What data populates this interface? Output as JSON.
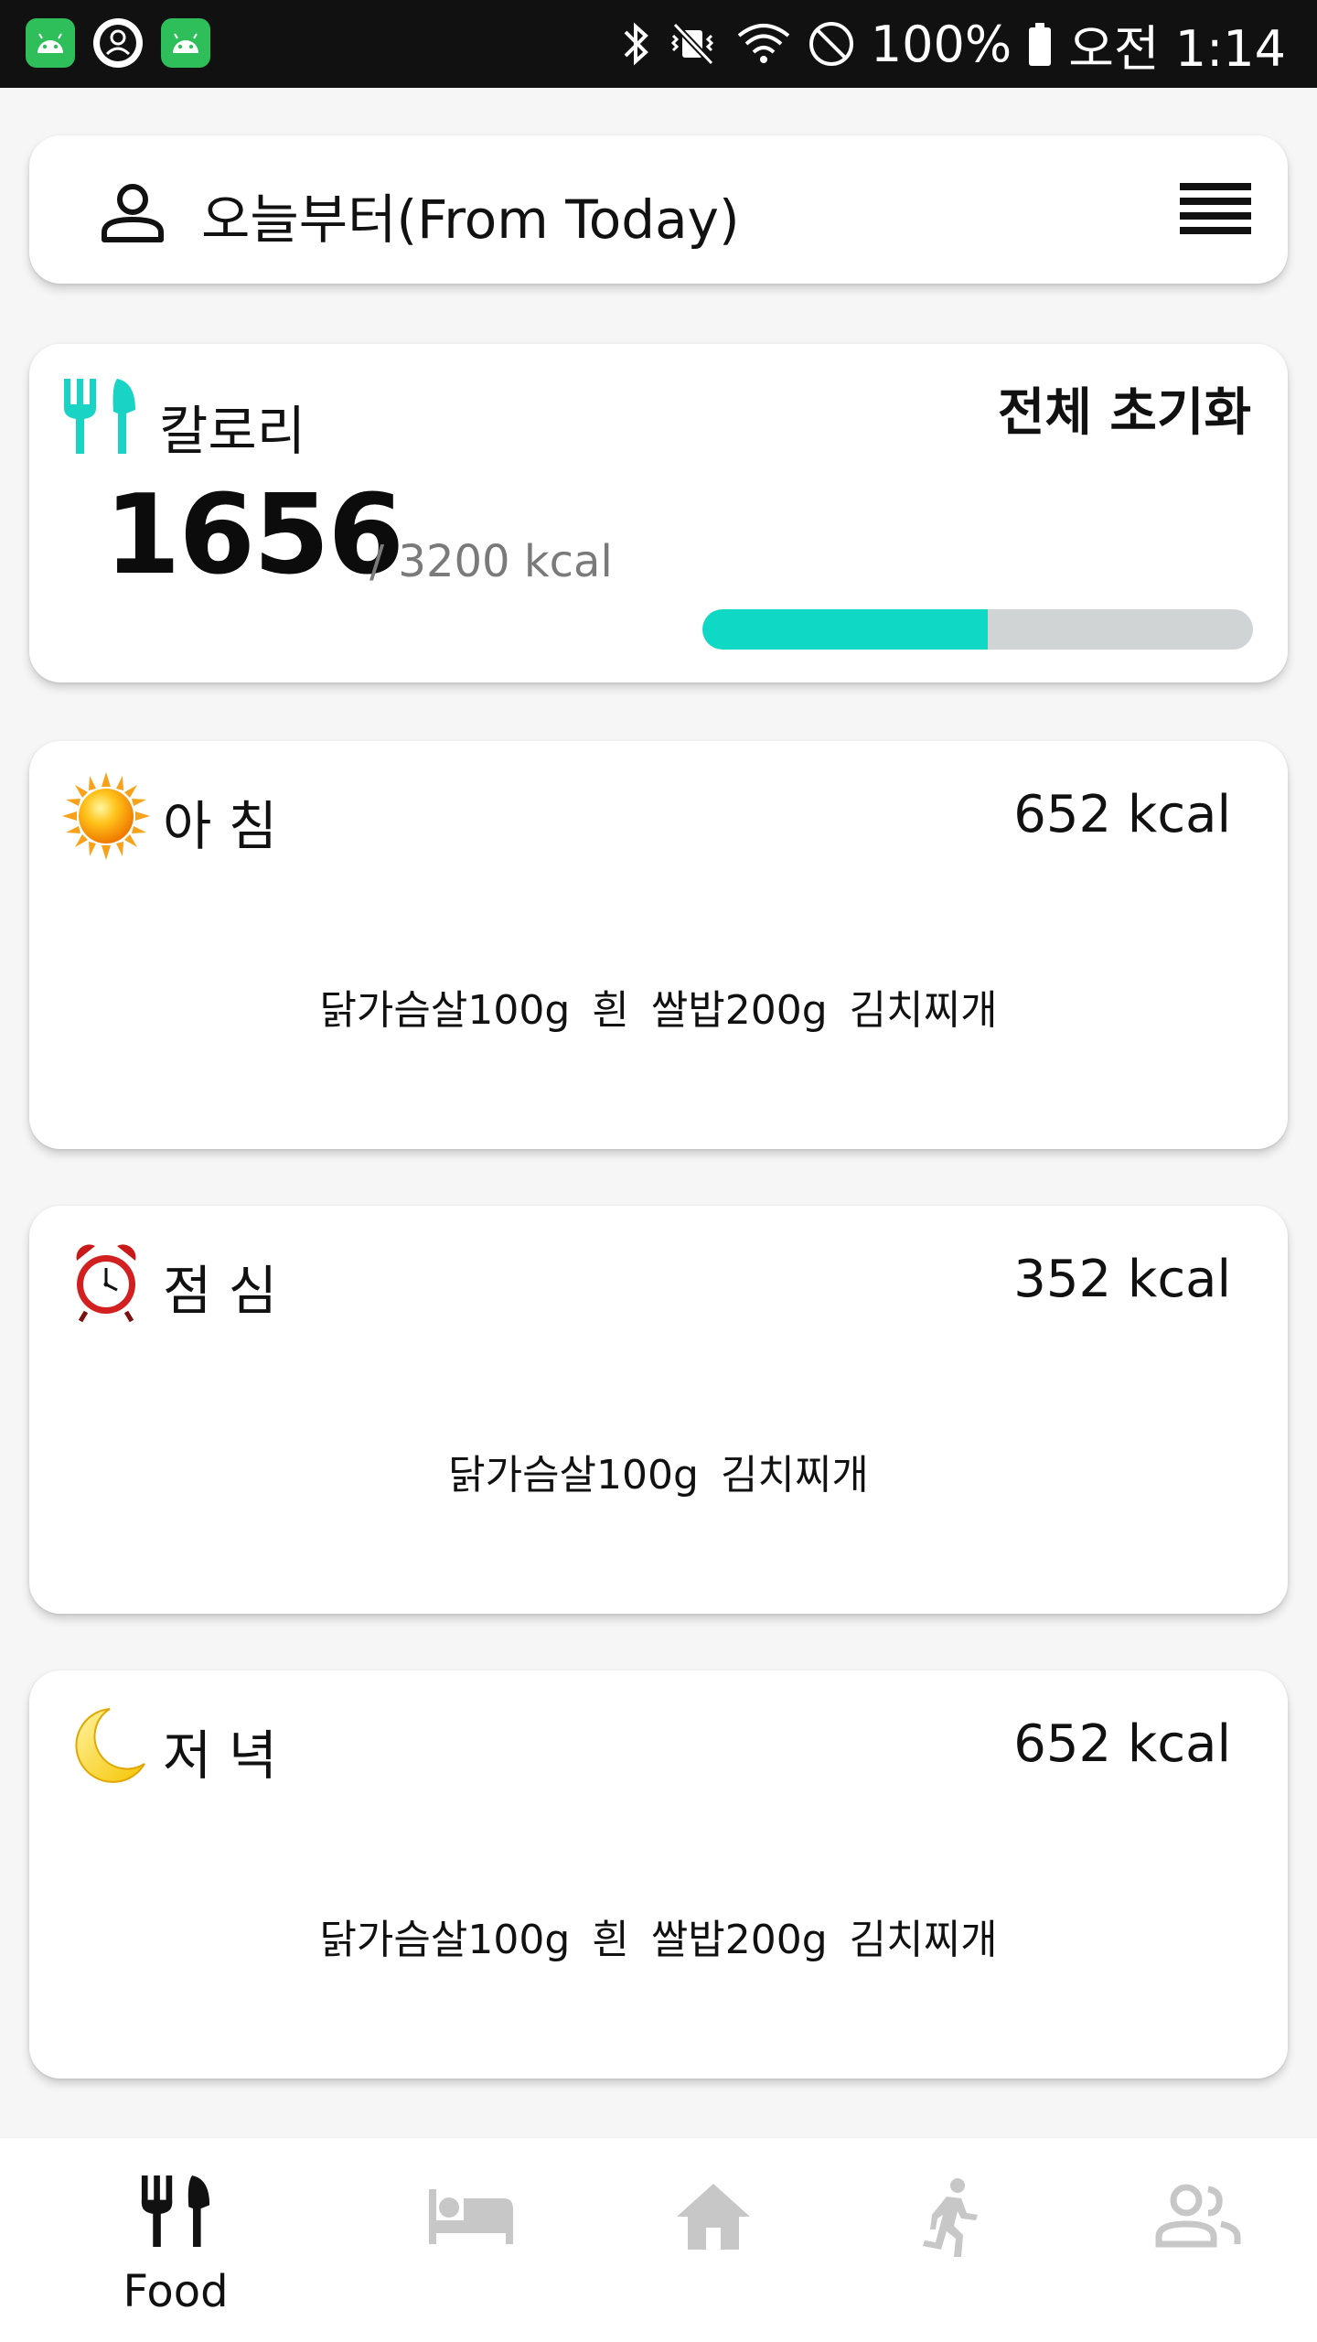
{
  "status_bar": {
    "battery": "100%",
    "time": "오전 1:14"
  },
  "header": {
    "title": "오늘부터(From Today)"
  },
  "calorie": {
    "label": "칼로리",
    "reset_label": "전체 초기화",
    "current": "1656",
    "goal_text": "/ 3200 kcal",
    "progress_fraction": 0.5175,
    "accent_color": "#0fd8c4"
  },
  "meals": [
    {
      "name": "아 침",
      "kcal": "652 kcal",
      "icon": "sun-icon",
      "items": [
        "닭가슴살100g",
        "흰 쌀밥200g",
        "김치찌개"
      ]
    },
    {
      "name": "점 심",
      "kcal": "352 kcal",
      "icon": "alarm-clock-icon",
      "items": [
        "닭가슴살100g",
        "김치찌개"
      ]
    },
    {
      "name": "저 녁",
      "kcal": "652 kcal",
      "icon": "moon-icon",
      "items": [
        "닭가슴살100g",
        "흰 쌀밥200g",
        "김치찌개"
      ]
    }
  ],
  "bottom_nav": {
    "items": [
      {
        "label": "Food",
        "icon": "fork-knife-icon",
        "active": true
      },
      {
        "label": "",
        "icon": "bed-icon",
        "active": false
      },
      {
        "label": "",
        "icon": "home-icon",
        "active": false
      },
      {
        "label": "",
        "icon": "running-icon",
        "active": false
      },
      {
        "label": "",
        "icon": "people-icon",
        "active": false
      }
    ]
  }
}
